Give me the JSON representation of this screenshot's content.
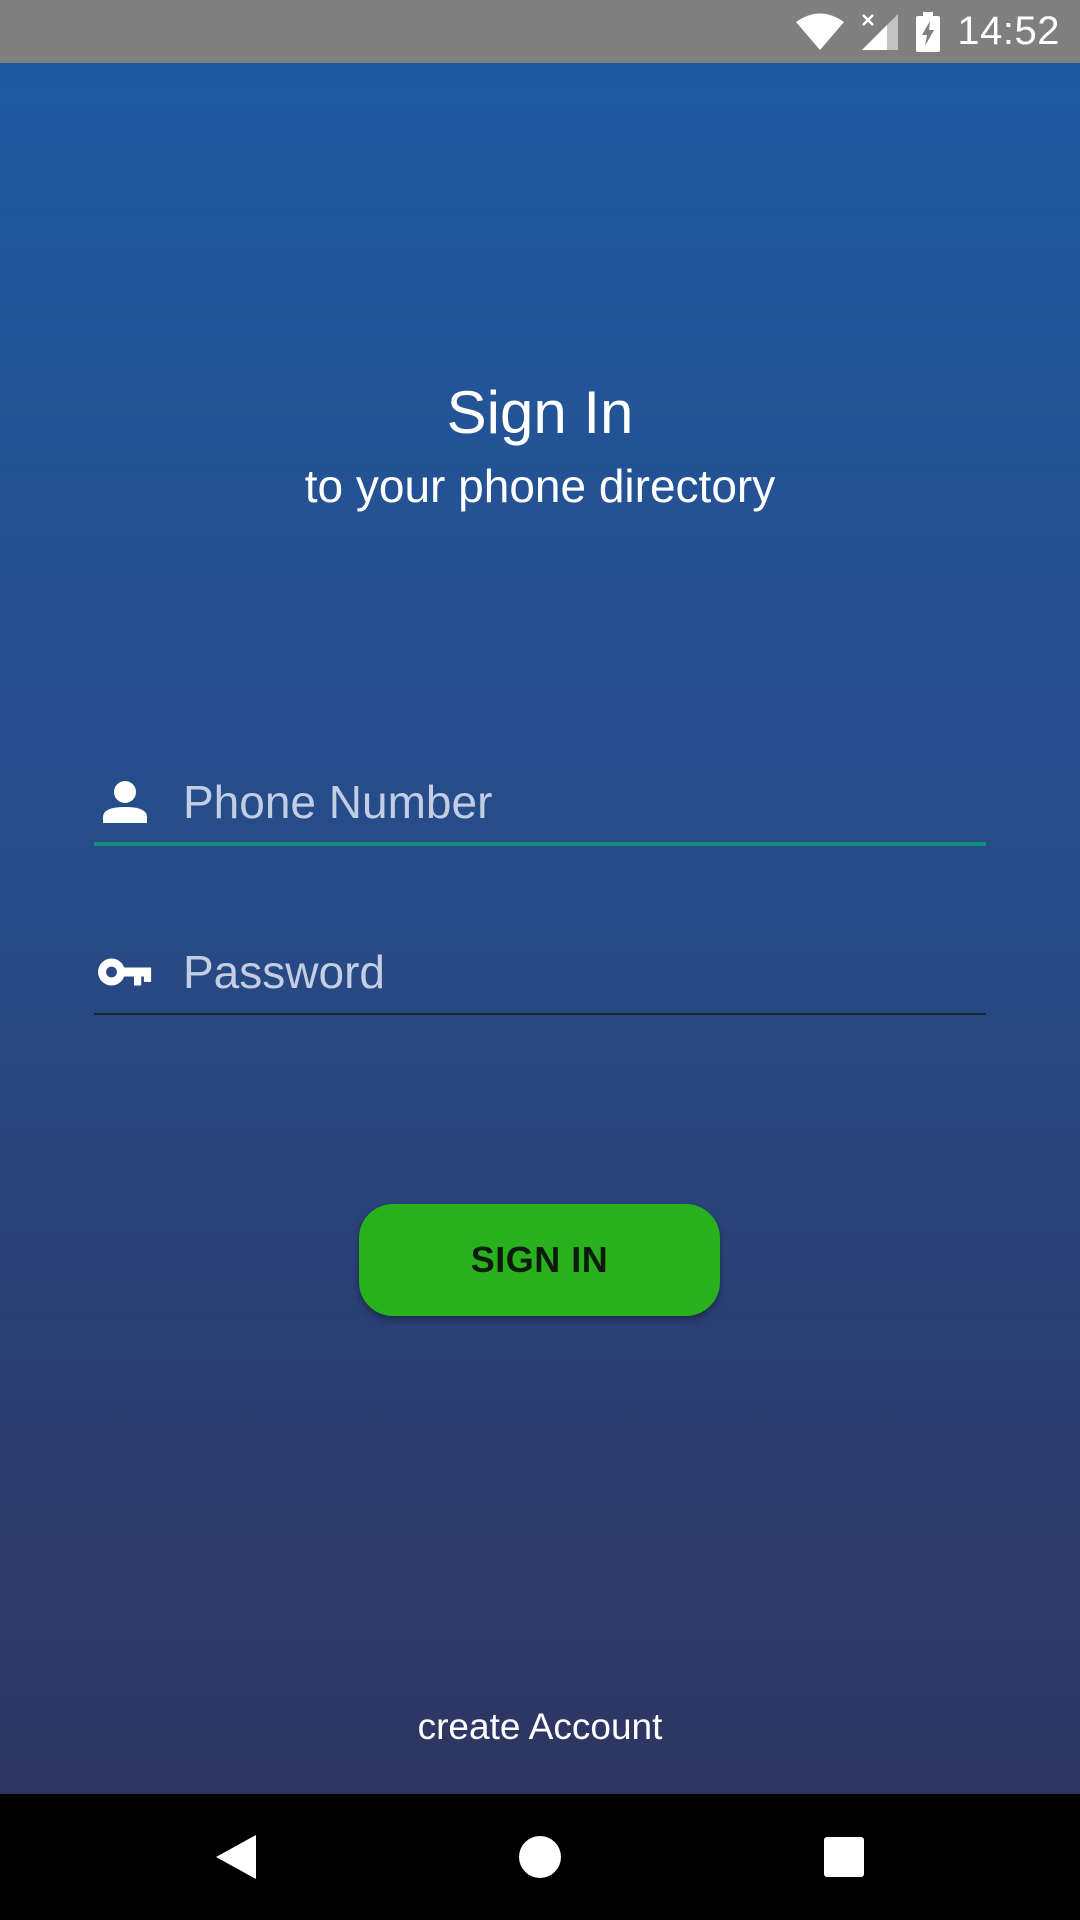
{
  "status_bar": {
    "time": "14:52",
    "icons": [
      "wifi-icon",
      "cellular-no-signal-icon",
      "battery-charging-icon"
    ]
  },
  "header": {
    "title": "Sign In",
    "subtitle": "to your phone directory"
  },
  "form": {
    "phone": {
      "placeholder": "Phone Number",
      "value": "",
      "icon": "person-icon"
    },
    "password": {
      "placeholder": "Password",
      "value": "",
      "icon": "key-icon"
    },
    "submit_label": "SIGN IN"
  },
  "footer": {
    "create_account_label": "create Account"
  },
  "nav_bar": {
    "buttons": [
      "back-icon",
      "home-icon",
      "recents-icon"
    ]
  },
  "colors": {
    "gradient_top": "#1f5aa1",
    "gradient_bottom": "#2e3560",
    "accent_underline": "#0f8f7c",
    "button_green": "#28b11c",
    "status_bar": "#7f7f7f"
  }
}
